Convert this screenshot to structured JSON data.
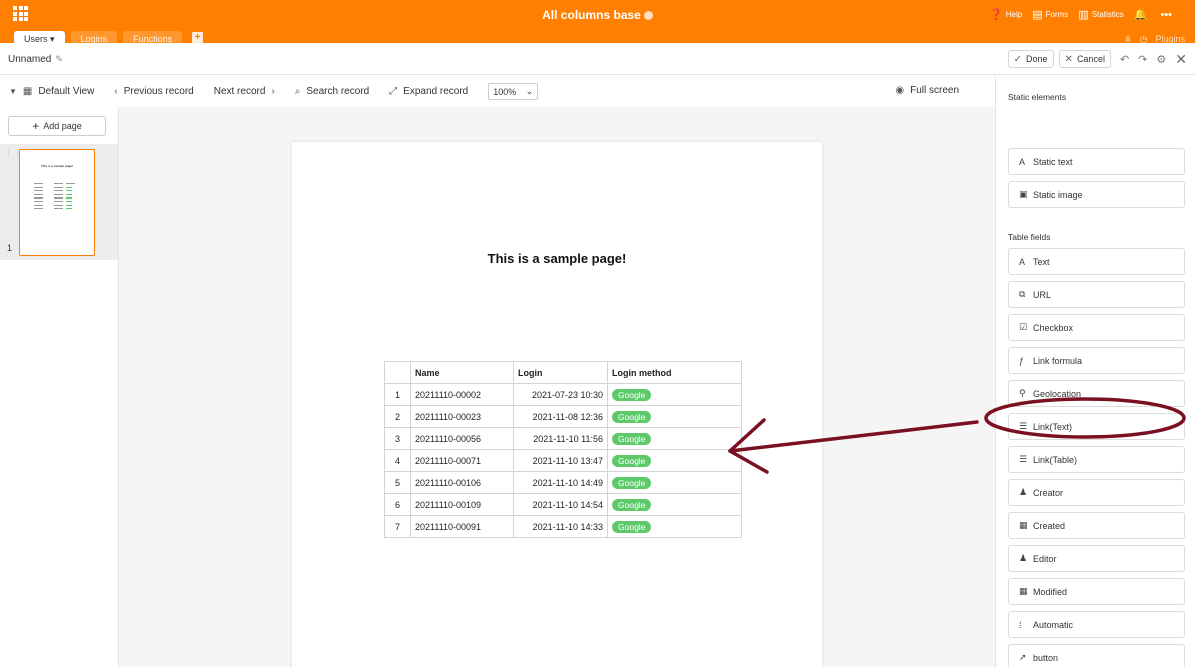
{
  "app": {
    "base_title": "All columns base",
    "help": "Help",
    "forms": "Forms",
    "statistics": "Statistics",
    "tabs": [
      "Users",
      "Logins",
      "Functions"
    ],
    "tab_right_plugins": "Plugins"
  },
  "dialog": {
    "report_name": "Unnamed",
    "done_label": "Done",
    "cancel_label": "Cancel"
  },
  "toolbar": {
    "view_label": "Default View",
    "prev_label": "Previous record",
    "next_label": "Next record",
    "search_label": "Search record",
    "expand_label": "Expand record",
    "zoom_value": "100%",
    "fullscreen_label": "Full screen"
  },
  "pages": {
    "add_page_label": "Add page",
    "page_number": "1"
  },
  "page": {
    "title": "This is a sample page!",
    "table": {
      "columns": [
        "",
        "Name",
        "Login",
        "Login method"
      ],
      "rows": [
        [
          "1",
          "20211110-00002",
          "2021-07-23 10:30",
          "Google"
        ],
        [
          "2",
          "20211110-00023",
          "2021-11-08 12:36",
          "Google"
        ],
        [
          "3",
          "20211110-00056",
          "2021-11-10 11:56",
          "Google"
        ],
        [
          "4",
          "20211110-00071",
          "2021-11-10 13:47",
          "Google"
        ],
        [
          "5",
          "20211110-00106",
          "2021-11-10 14:49",
          "Google"
        ],
        [
          "6",
          "20211110-00109",
          "2021-11-10 14:54",
          "Google"
        ],
        [
          "7",
          "20211110-00091",
          "2021-11-10 14:33",
          "Google"
        ]
      ]
    }
  },
  "panel": {
    "static_heading": "Static elements",
    "static_items": [
      {
        "label": "Static text",
        "icon": "text-icon"
      },
      {
        "label": "Static image",
        "icon": "image-icon"
      }
    ],
    "fields_heading": "Table fields",
    "field_items": [
      {
        "label": "Text",
        "icon": "text-icon"
      },
      {
        "label": "URL",
        "icon": "link-icon"
      },
      {
        "label": "Checkbox",
        "icon": "checkbox-icon"
      },
      {
        "label": "Link formula",
        "icon": "formula-icon"
      },
      {
        "label": "Geolocation",
        "icon": "location-icon"
      },
      {
        "label": "Link(Text)",
        "icon": "list-icon"
      },
      {
        "label": "Link(Table)",
        "icon": "list-icon"
      },
      {
        "label": "Creator",
        "icon": "person-icon"
      },
      {
        "label": "Created",
        "icon": "calendar-icon"
      },
      {
        "label": "Editor",
        "icon": "person-icon"
      },
      {
        "label": "Modified",
        "icon": "calendar-icon"
      },
      {
        "label": "Automatic",
        "icon": "autonumber-icon"
      },
      {
        "label": "button",
        "icon": "cursor-icon"
      }
    ]
  },
  "colors": {
    "brand": "#ff8000",
    "badge": "#5dc96b",
    "annotation": "#7a1020"
  }
}
